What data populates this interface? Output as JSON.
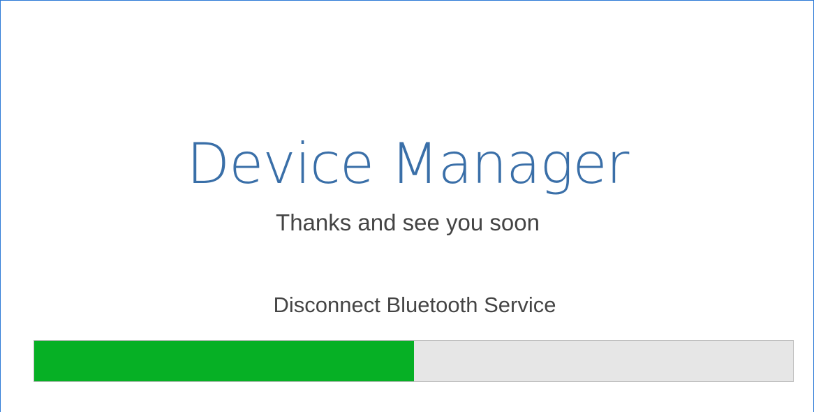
{
  "app": {
    "title": "Device Manager",
    "subtitle": "Thanks and see you soon"
  },
  "status": {
    "message": "Disconnect Bluetooth Service",
    "progress_fraction": 0.5,
    "progress_color": "#06b025",
    "track_color": "#e6e6e6"
  },
  "colors": {
    "window_border": "#2b79d6",
    "title": "#3a6fa8",
    "text": "#444444"
  }
}
